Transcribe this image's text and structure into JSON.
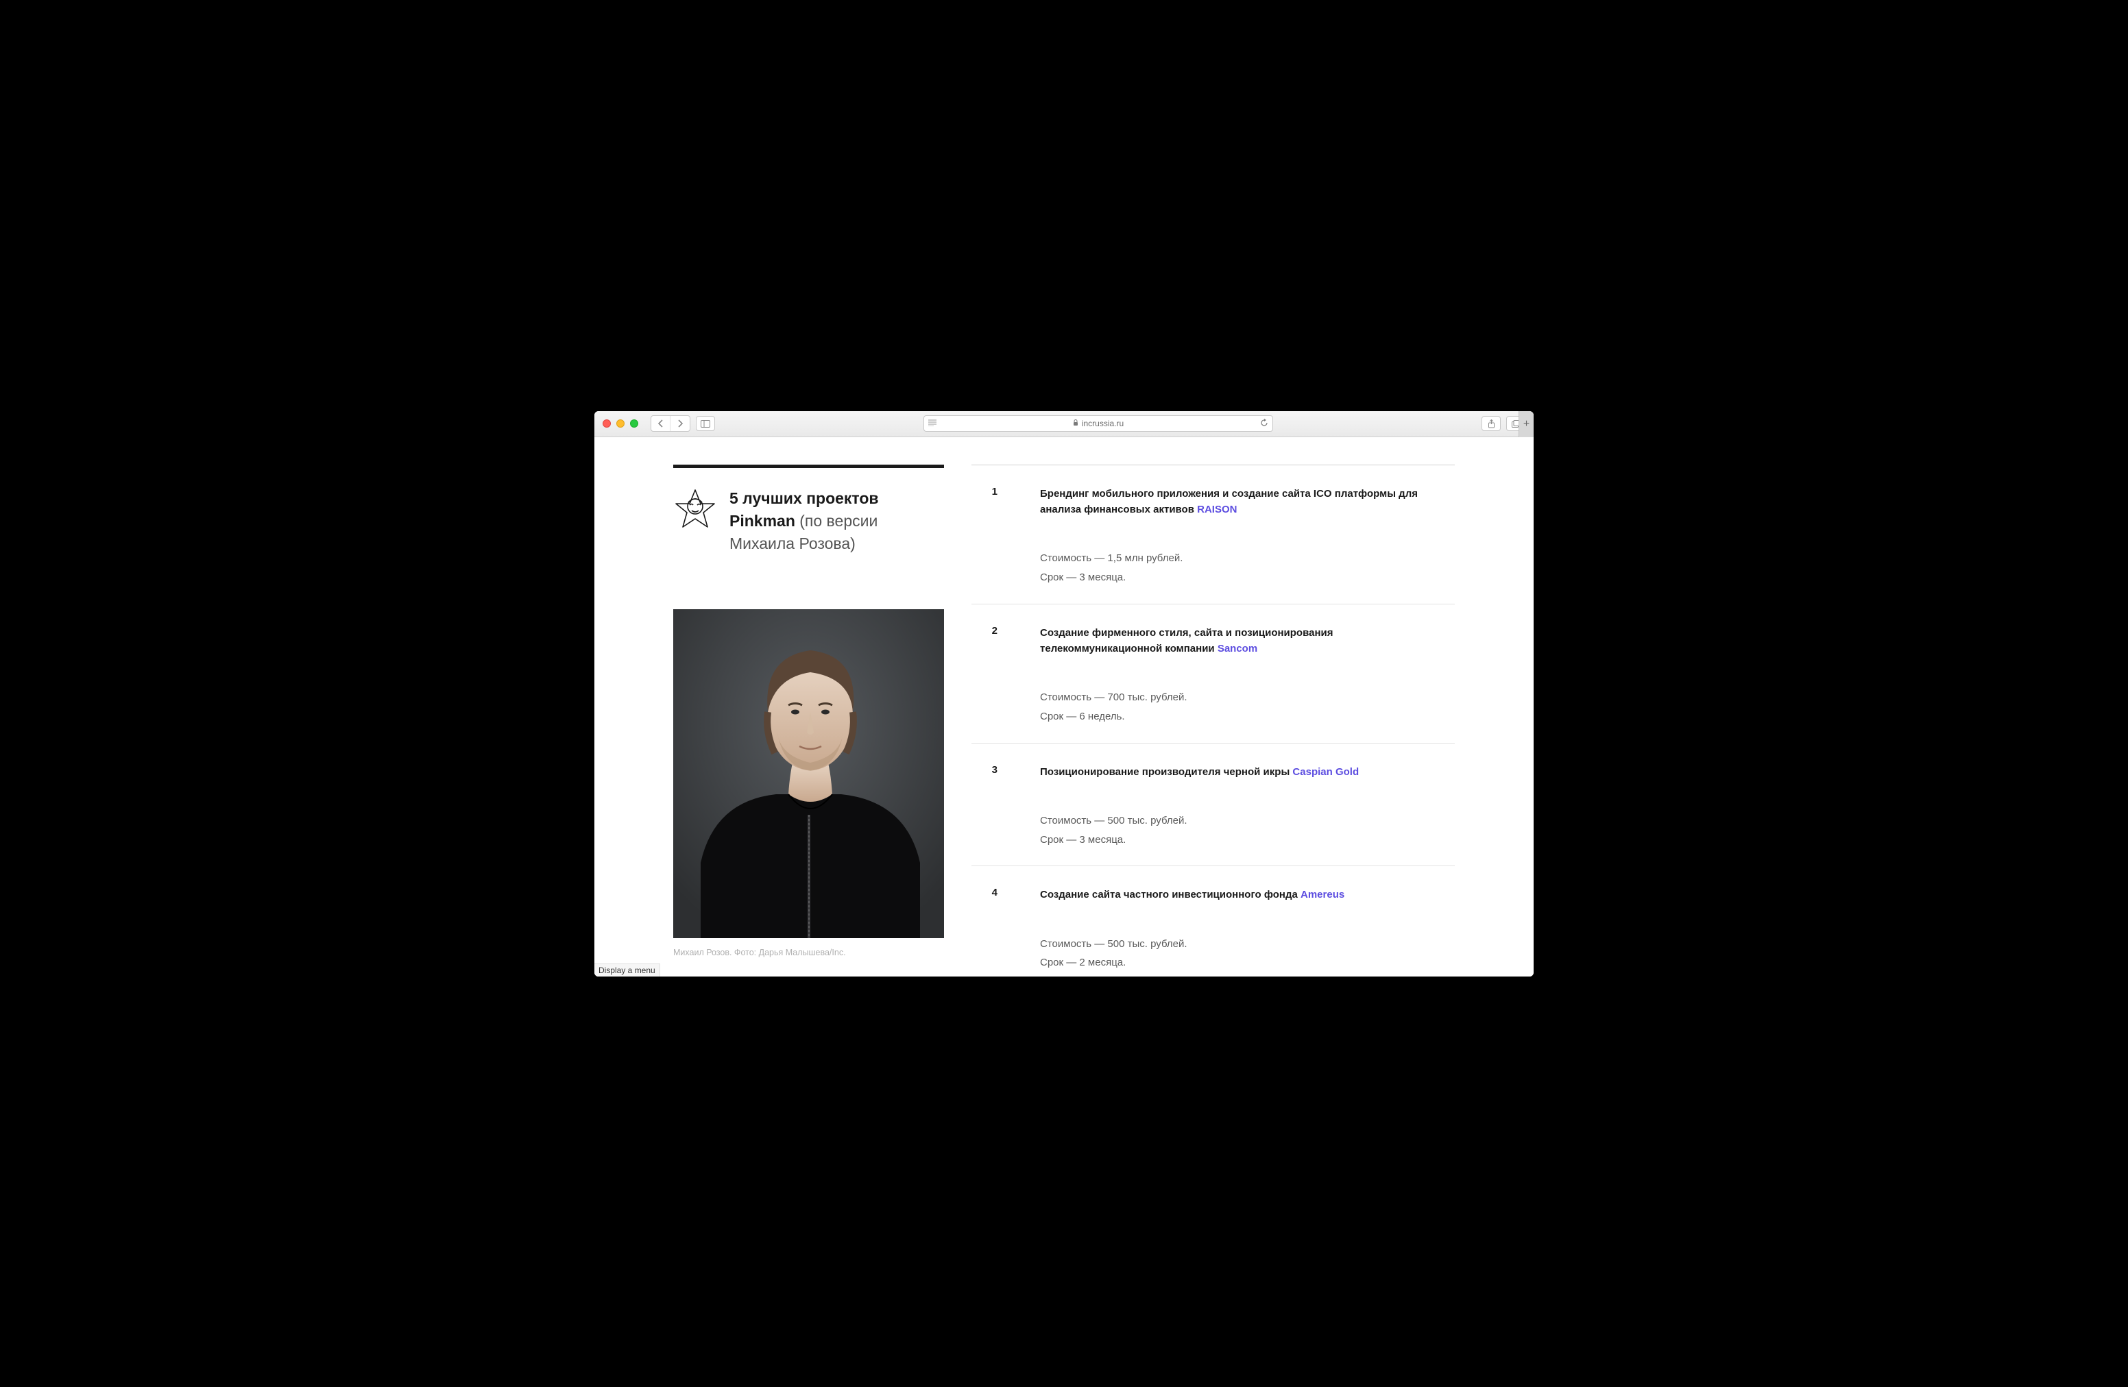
{
  "browser": {
    "domain": "incrussia.ru",
    "status_text": "Display a menu"
  },
  "article": {
    "title_bold": "5 лучших проектов Pinkman",
    "title_rest": " (по версии Михаила Розова)",
    "photo_caption": "Михаил Розов. Фото: Дарья Малышева/Inc."
  },
  "projects": [
    {
      "num": "1",
      "desc_pre": "Брендинг мобильного приложения и создание сайта ICO платформы для анализа финансовых активов ",
      "brand": "RAISON",
      "cost": "Стоимость — 1,5 млн рублей.",
      "term": "Срок — 3 месяца."
    },
    {
      "num": "2",
      "desc_pre": "Создание фирменного стиля, сайта и позиционирования телекоммуникационной компании ",
      "brand": "Sancom",
      "cost": "Стоимость — 700 тыс. рублей.",
      "term": "Срок — 6 недель."
    },
    {
      "num": "3",
      "desc_pre": "Позиционирование производителя черной икры ",
      "brand": "Caspian Gold",
      "cost": "Стоимость — 500 тыс. рублей.",
      "term": "Срок — 3 месяца."
    },
    {
      "num": "4",
      "desc_pre": "Создание сайта частного инвестиционного фонда ",
      "brand": "Amereus",
      "cost": "Стоимость — 500 тыс. рублей.",
      "term": "Срок — 2 месяца."
    }
  ]
}
